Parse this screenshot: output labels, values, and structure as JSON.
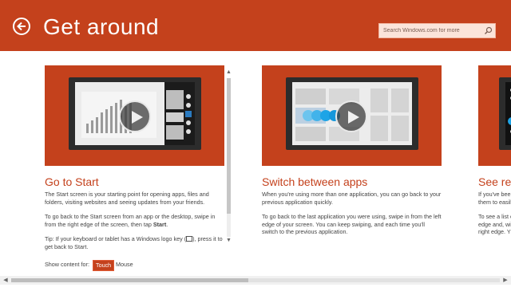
{
  "header": {
    "title": "Get around",
    "back_icon": "back-arrow-icon",
    "accent_color": "#c4411c"
  },
  "search": {
    "placeholder": "Search Windows.com for more",
    "icon": "search-icon"
  },
  "cards": [
    {
      "title": "Go to Start",
      "paragraph1": "The Start screen is your starting point for opening apps, files and folders, visiting websites and seeing updates from your friends.",
      "paragraph2_pre": "To go back to the Start screen from an app or the desktop, swipe in from the right edge of the screen, then tap ",
      "paragraph2_bold": "Start",
      "paragraph2_post": ".",
      "tip_pre": "Tip: If your keyboard or tablet has a Windows logo key (",
      "tip_post": "), press it to get back to Start."
    },
    {
      "title": "Switch between apps",
      "paragraph1": "When you're using more than one application, you can go back to your previous application quickly.",
      "paragraph2": "To go back to the last application you were using, swipe in from the left edge of your screen. You can keep swiping, and each time you'll switch to the previous application."
    },
    {
      "title": "See rece",
      "line1": "If you've bee",
      "line2": "them to easily",
      "line3": "To see a list c",
      "line4": "edge and, wit",
      "line5": "right edge. Y"
    }
  ],
  "content_toggle": {
    "label": "Show content for:",
    "options": [
      "Touch",
      "Mouse"
    ],
    "selected": "Touch"
  }
}
